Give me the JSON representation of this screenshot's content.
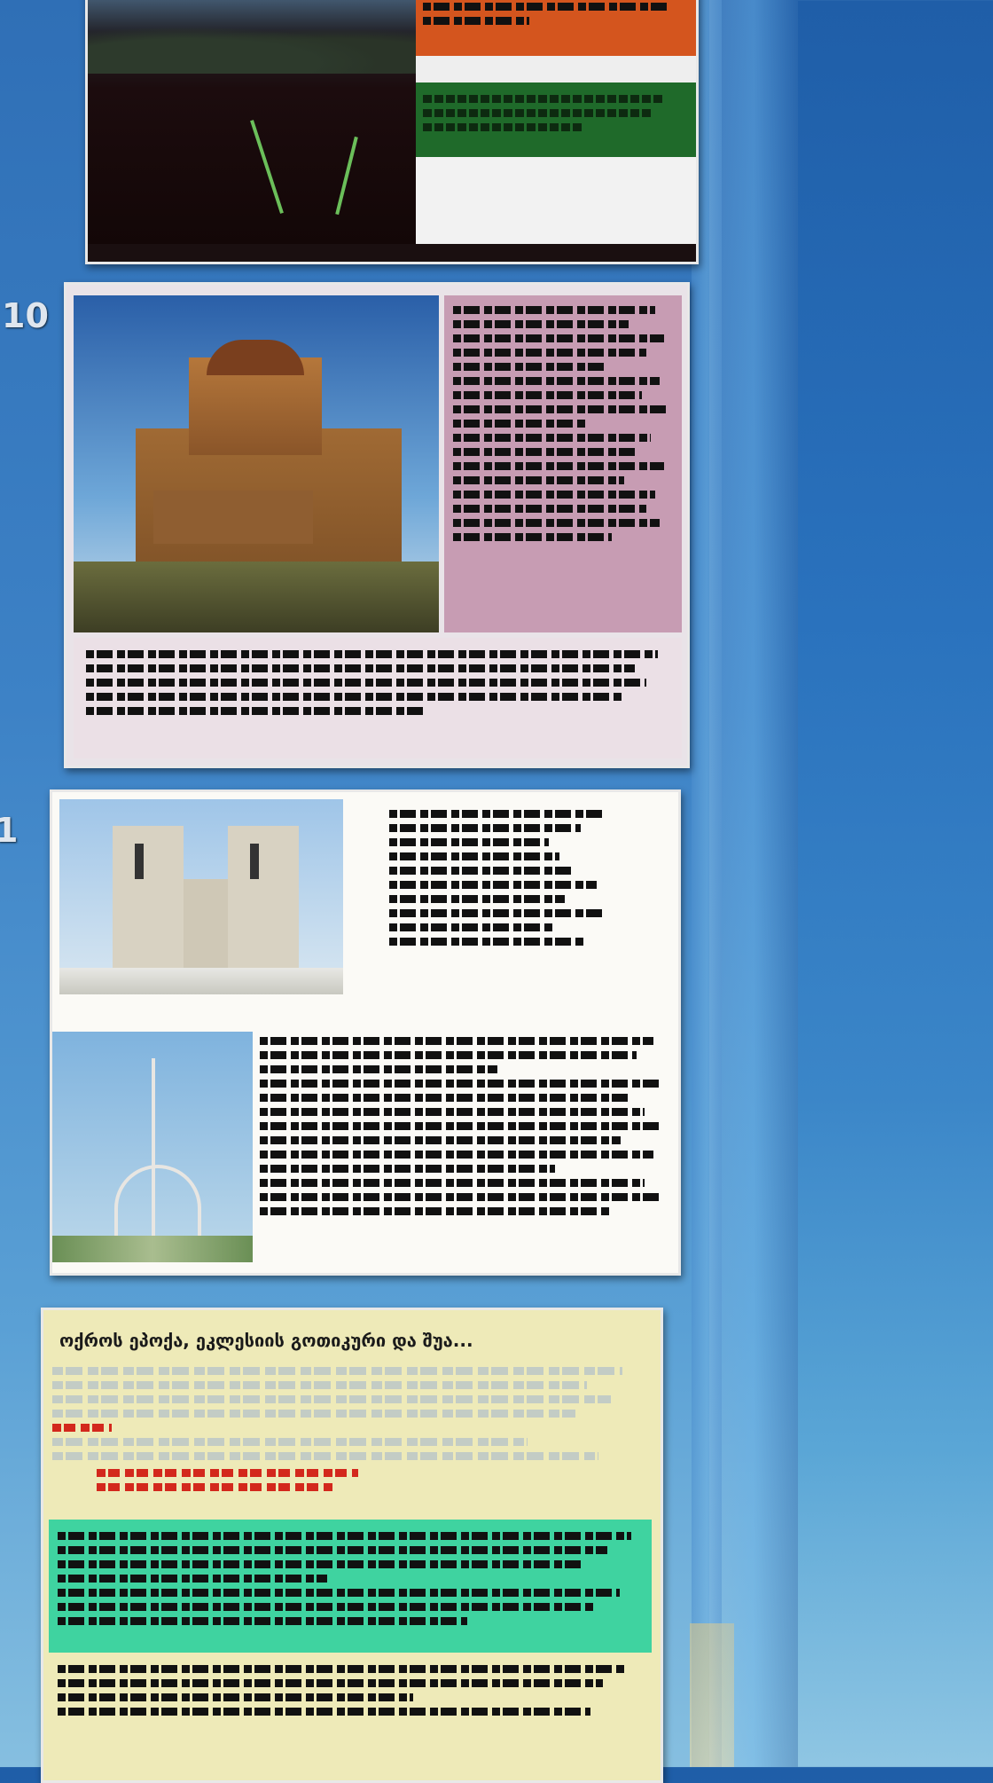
{
  "slides": [
    {
      "number": ""
    },
    {
      "number": "10"
    },
    {
      "number": "1"
    },
    {
      "number": ""
    }
  ],
  "slide12": {
    "title": "ოქროს ეპოქა, ეკლესიის გოთიკური და შუა..."
  },
  "colors": {
    "panel_blue": "#2f6fb6",
    "slide9_orange": "#d4551e",
    "slide9_green": "#1f6a2a",
    "slide10_pink": "#c79cb3",
    "slide12_yellow": "#eeeab8",
    "slide12_teal": "#3fd3a0",
    "accent_red": "#d3281c"
  },
  "icons": [
    "church-image",
    "notre-dame-image",
    "eiffel-tower-image",
    "road-landscape-image"
  ]
}
